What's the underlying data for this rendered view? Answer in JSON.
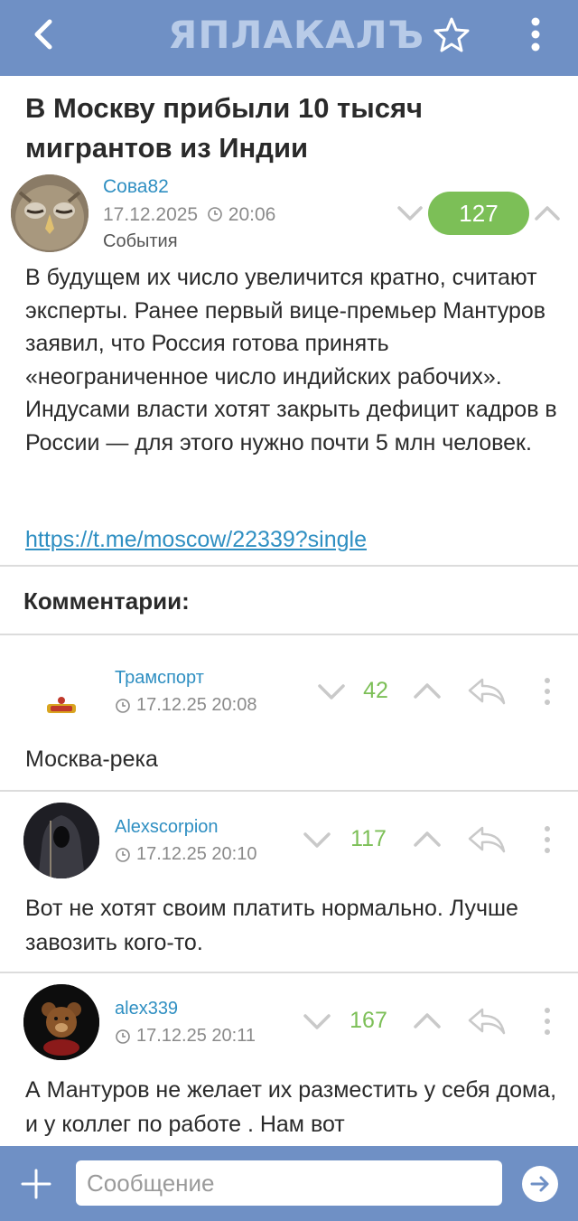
{
  "app": {
    "logo": "ЯПЛАКАЛЪ",
    "colors": {
      "bar": "#6f90c5",
      "accent": "#2f8fc2",
      "rating": "#7cbf57"
    }
  },
  "post": {
    "title": "В Москву прибыли 10 тысяч мигрантов из Индии",
    "author": "Сова82",
    "date": "17.12.2025",
    "time": "20:06",
    "category": "События",
    "rating": "127",
    "body": "В будущем их число увеличится кратно, считают эксперты. Ранее первый вице-премьер Мантуров заявил, что Россия готова принять «неограниченное число индийских рабочих». Индусами власти хотят закрыть дефицит кадров в России — для этого нужно почти 5 млн человек.",
    "link": "https://t.me/moscow/22339?single"
  },
  "comments_heading": "Комментарии:",
  "comments": [
    {
      "author": "Трамспорт",
      "datetime": "17.12.25 20:08",
      "score": "42",
      "text": "Москва-река"
    },
    {
      "author": "Alexscorpion",
      "datetime": "17.12.25 20:10",
      "score": "117",
      "text": "Вот не хотят своим платить нормально. Лучше завозить кого-то."
    },
    {
      "author": "alex339",
      "datetime": "17.12.25 20:11",
      "score": "167",
      "text": "А Мантуров не желает их разместить у себя дома, и у коллег по работе . Нам вот"
    }
  ],
  "composer": {
    "placeholder": "Сообщение"
  },
  "icons": {
    "back": "chevron-left-icon",
    "favorite": "star-icon",
    "menu": "more-vertical-icon",
    "clock": "clock-icon",
    "vote_down": "chevron-down-icon",
    "vote_up": "chevron-up-icon",
    "reply": "reply-icon",
    "attach": "plus-icon",
    "send": "send-arrow-icon"
  }
}
